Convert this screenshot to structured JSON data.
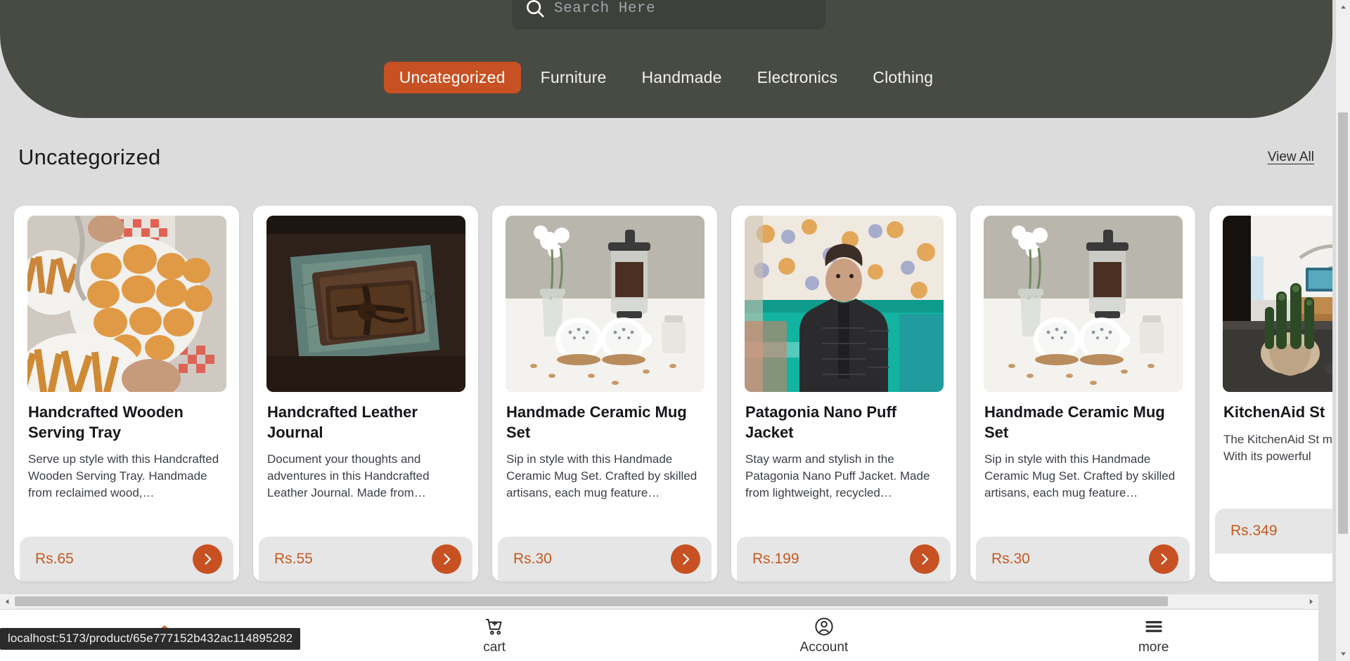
{
  "search": {
    "placeholder": "Search Here",
    "value": "",
    "icon": "search-icon"
  },
  "categories": [
    {
      "label": "Uncategorized",
      "active": true
    },
    {
      "label": "Furniture",
      "active": false
    },
    {
      "label": "Handmade",
      "active": false
    },
    {
      "label": "Electronics",
      "active": false
    },
    {
      "label": "Clothing",
      "active": false
    }
  ],
  "section": {
    "title": "Uncategorized",
    "view_all": "View All"
  },
  "products": [
    {
      "title": "Handcrafted Wooden Serving Tray",
      "description": "Serve up style with this Handcrafted Wooden Serving Tray. Handmade from reclaimed wood,…",
      "price": "Rs.65",
      "image_alt": "plate-of-nuggets-and-fries"
    },
    {
      "title": "Handcrafted Leather Journal",
      "description": "Document your thoughts and adventures in this Handcrafted Leather Journal. Made from…",
      "price": "Rs.55",
      "image_alt": "leather-journal-on-wood"
    },
    {
      "title": "Handmade Ceramic Mug Set",
      "description": "Sip in style with this Handmade Ceramic Mug Set. Crafted by skilled artisans, each mug feature…",
      "price": "Rs.30",
      "image_alt": "ceramic-mugs-and-french-press"
    },
    {
      "title": "Patagonia Nano Puff Jacket",
      "description": "Stay warm and stylish in the Patagonia Nano Puff Jacket. Made from lightweight, recycled…",
      "price": "Rs.199",
      "image_alt": "man-in-black-puffer-jacket"
    },
    {
      "title": "Handmade Ceramic Mug Set",
      "description": "Sip in style with this Handmade Ceramic Mug Set. Crafted by skilled artisans, each mug feature…",
      "price": "Rs.30",
      "image_alt": "ceramic-mugs-and-french-press"
    },
    {
      "title": "KitchenAid St",
      "description": "The KitchenAid St must-have for any With its powerful",
      "price": "Rs.349",
      "image_alt": "cactus-in-modern-living-room"
    }
  ],
  "bottom_nav": [
    {
      "label": "",
      "icon": "home-icon",
      "active": true
    },
    {
      "label": "cart",
      "icon": "cart-icon",
      "active": false
    },
    {
      "label": "Account",
      "icon": "account-icon",
      "active": false
    },
    {
      "label": "more",
      "icon": "hamburger-icon",
      "active": false
    }
  ],
  "status_bar": {
    "url": "localhost:5173/product/65e777152b432ac114895282"
  },
  "colors": {
    "header_bg": "#484a44",
    "accent": "#c75122",
    "price_text": "#c25a22",
    "page_bg": "#dcdcdc",
    "card_bg": "#ffffff"
  }
}
